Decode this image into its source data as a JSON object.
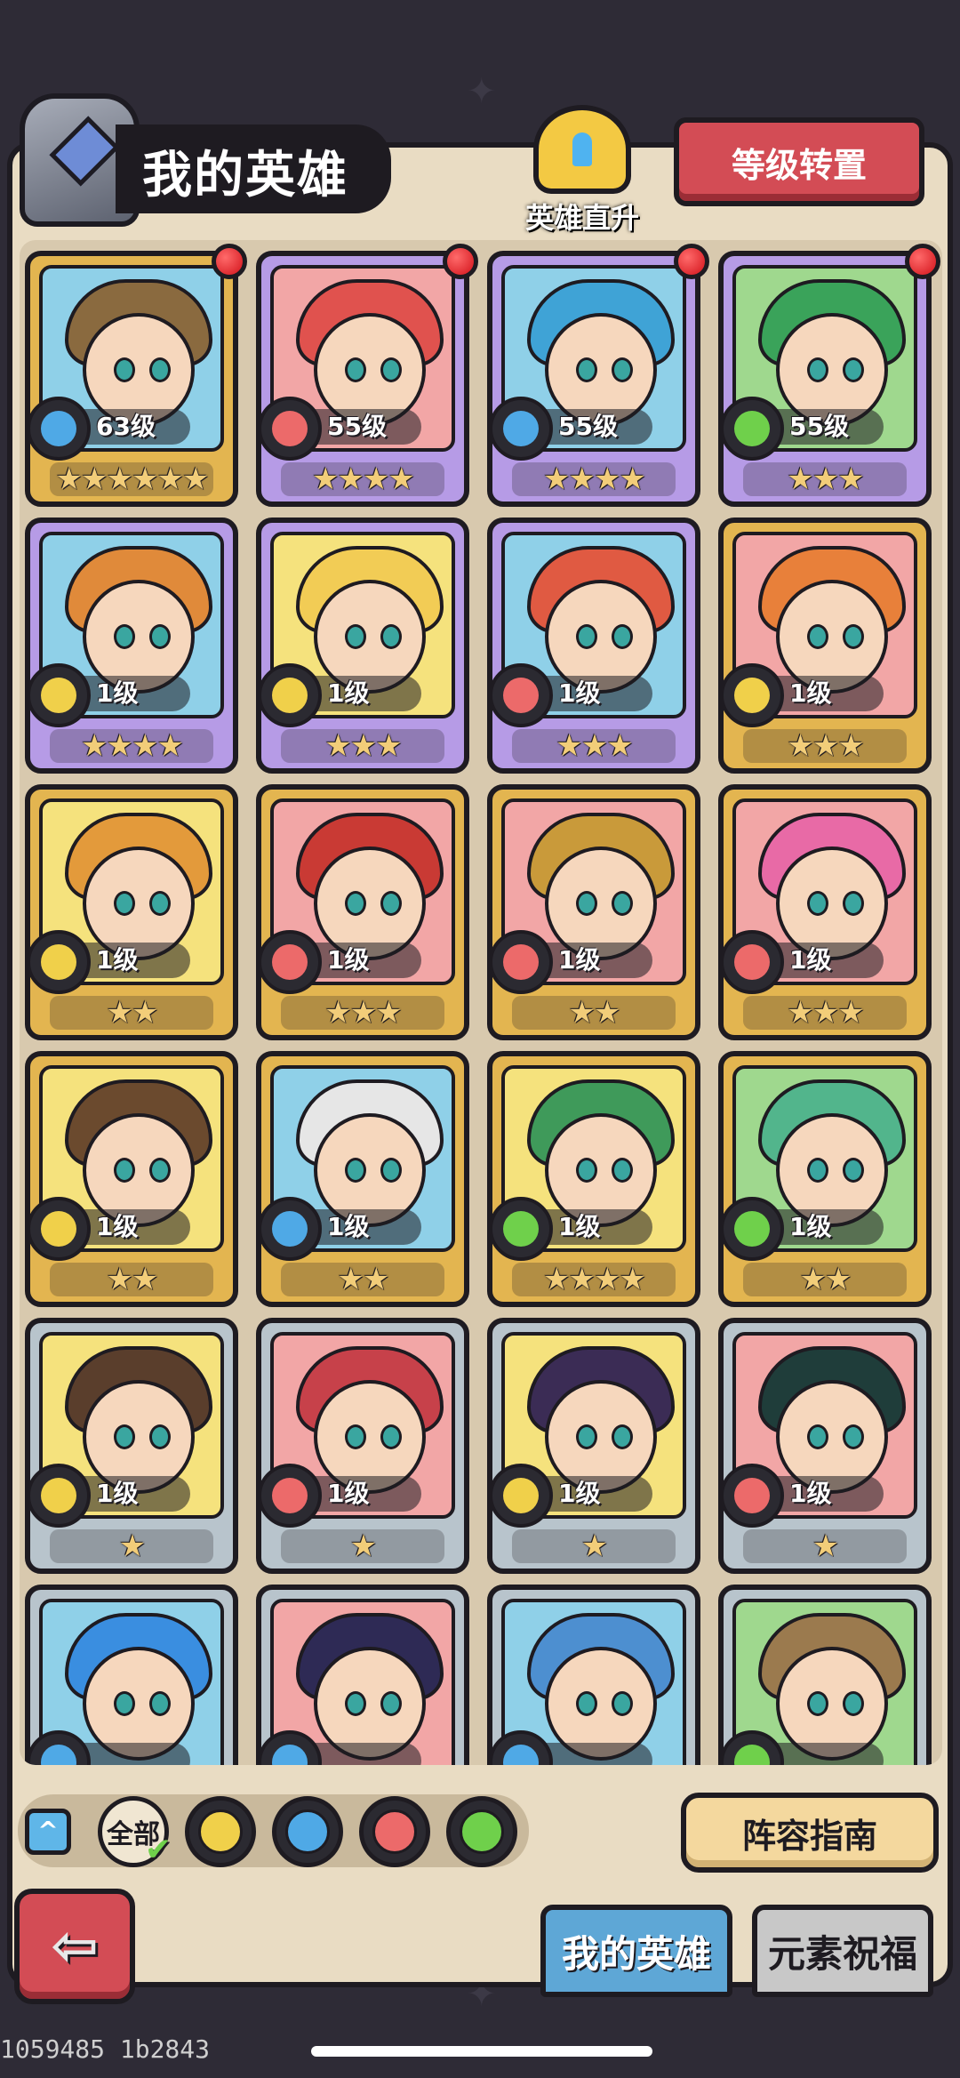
{
  "header": {
    "title": "我的英雄",
    "direct_upgrade_label": "英雄直升",
    "level_transfer_label": "等级转置"
  },
  "heroes": [
    {
      "level": "63级",
      "stars": "★★★★★★",
      "rarity": "gold",
      "element": "water",
      "badge": true,
      "hair": "#8a6a3f",
      "bg": "#8fd0e8"
    },
    {
      "level": "55级",
      "stars": "★★★★",
      "rarity": "purple",
      "element": "fire",
      "badge": true,
      "hair": "#e0524e",
      "bg": "#f2a6a6"
    },
    {
      "level": "55级",
      "stars": "★★★★",
      "rarity": "purple",
      "element": "water",
      "badge": true,
      "hair": "#3fa3d6",
      "bg": "#8fd0e8"
    },
    {
      "level": "55级",
      "stars": "★★★",
      "rarity": "purple",
      "element": "wind",
      "badge": true,
      "hair": "#3aa35a",
      "bg": "#9fd88e"
    },
    {
      "level": "1级",
      "stars": "★★★★",
      "rarity": "purple",
      "element": "earth",
      "badge": false,
      "hair": "#e08a3a",
      "bg": "#8fd0e8"
    },
    {
      "level": "1级",
      "stars": "★★★",
      "rarity": "purple",
      "element": "earth",
      "badge": false,
      "hair": "#f2cc55",
      "bg": "#f5e27d"
    },
    {
      "level": "1级",
      "stars": "★★★",
      "rarity": "purple",
      "element": "fire",
      "badge": false,
      "hair": "#e05a42",
      "bg": "#8fd0e8"
    },
    {
      "level": "1级",
      "stars": "★★★",
      "rarity": "gold",
      "element": "earth",
      "badge": false,
      "hair": "#e8803a",
      "bg": "#f2a6a6"
    },
    {
      "level": "1级",
      "stars": "★★",
      "rarity": "gold",
      "element": "earth",
      "badge": false,
      "hair": "#e39a3b",
      "bg": "#f5e27d"
    },
    {
      "level": "1级",
      "stars": "★★★",
      "rarity": "gold",
      "element": "fire",
      "badge": false,
      "hair": "#c93a34",
      "bg": "#f2a6a6"
    },
    {
      "level": "1级",
      "stars": "★★",
      "rarity": "gold",
      "element": "fire",
      "badge": false,
      "hair": "#c99a3a",
      "bg": "#f2a6a6"
    },
    {
      "level": "1级",
      "stars": "★★★",
      "rarity": "gold",
      "element": "fire",
      "badge": false,
      "hair": "#e86aa6",
      "bg": "#f2a6a6"
    },
    {
      "level": "1级",
      "stars": "★★",
      "rarity": "gold",
      "element": "earth",
      "badge": false,
      "hair": "#6b4a2e",
      "bg": "#f5e27d"
    },
    {
      "level": "1级",
      "stars": "★★",
      "rarity": "gold",
      "element": "water",
      "badge": false,
      "hair": "#e6e6e6",
      "bg": "#8fd0e8"
    },
    {
      "level": "1级",
      "stars": "★★★★",
      "rarity": "gold",
      "element": "wind",
      "badge": false,
      "hair": "#3f9a5a",
      "bg": "#f5e27d"
    },
    {
      "level": "1级",
      "stars": "★★",
      "rarity": "gold",
      "element": "wind",
      "badge": false,
      "hair": "#52b58c",
      "bg": "#9fd88e"
    },
    {
      "level": "1级",
      "stars": "★",
      "rarity": "silver",
      "element": "earth",
      "badge": false,
      "hair": "#5a3e2c",
      "bg": "#f5e27d"
    },
    {
      "level": "1级",
      "stars": "★",
      "rarity": "silver",
      "element": "fire",
      "badge": false,
      "hair": "#c7414a",
      "bg": "#f2a6a6"
    },
    {
      "level": "1级",
      "stars": "★",
      "rarity": "silver",
      "element": "earth",
      "badge": false,
      "hair": "#3b2c55",
      "bg": "#f5e27d"
    },
    {
      "level": "1级",
      "stars": "★",
      "rarity": "silver",
      "element": "fire",
      "badge": false,
      "hair": "#1f3d3a",
      "bg": "#f2a6a6"
    },
    {
      "level": "",
      "stars": "",
      "rarity": "silver",
      "element": "water",
      "badge": false,
      "hair": "#3a8ee0",
      "bg": "#8fd0e8"
    },
    {
      "level": "",
      "stars": "",
      "rarity": "silver",
      "element": "water",
      "badge": false,
      "hair": "#2e2a55",
      "bg": "#f2a6a6"
    },
    {
      "level": "",
      "stars": "",
      "rarity": "silver",
      "element": "water",
      "badge": false,
      "hair": "#4d8fd0",
      "bg": "#8fd0e8"
    },
    {
      "level": "",
      "stars": "",
      "rarity": "silver",
      "element": "wind",
      "badge": false,
      "hair": "#9b7a4e",
      "bg": "#9fd88e"
    }
  ],
  "element_colors": {
    "water": "#4fa9e6",
    "fire": "#ec6a6a",
    "wind": "#6fd04b",
    "earth": "#f0d04a"
  },
  "filters": {
    "all_label": "全部",
    "elements": [
      "earth",
      "water",
      "fire",
      "wind"
    ]
  },
  "guide_label": "阵容指南",
  "tabs": {
    "my_heroes": "我的英雄",
    "element_blessing": "元素祝福"
  },
  "debug_text": "1059485 1b2843"
}
